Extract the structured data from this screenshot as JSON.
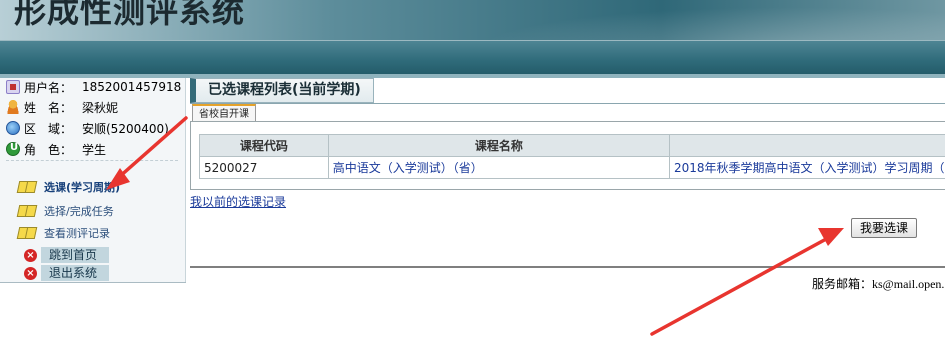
{
  "header": {
    "title": "形成性测评系统"
  },
  "sidebar": {
    "user_info": [
      {
        "icon": "user-card-icon",
        "label": "用户名：",
        "value": "1852001457918"
      },
      {
        "icon": "person-icon",
        "label": "姓　名：",
        "value": "梁秋妮"
      },
      {
        "icon": "globe-icon",
        "label": "区　域：",
        "value": "安顺(5200400)"
      },
      {
        "icon": "role-icon",
        "label": "角　色：",
        "value": "学生"
      }
    ],
    "menu": [
      {
        "icon": "book-icon",
        "label": "选课(学习周期)",
        "active": true
      },
      {
        "icon": "book-icon",
        "label": "选择/完成任务",
        "active": false
      },
      {
        "icon": "book-icon",
        "label": "查看测评记录",
        "active": false
      }
    ],
    "system": [
      {
        "icon": "close-icon",
        "label": "跳到首页"
      },
      {
        "icon": "close-icon",
        "label": "退出系统"
      }
    ]
  },
  "main": {
    "title": "已选课程列表(当前学期)",
    "tab": "省校自开课",
    "table": {
      "headers": [
        "课程代码",
        "课程名称",
        ""
      ],
      "rows": [
        {
          "code": "5200027",
          "name": "高中语文（入学测试）（省）",
          "period": "2018年秋季学期高中语文（入学测试）学习周期（"
        }
      ]
    },
    "history_link": "我以前的选课记录",
    "select_button": "我要选课",
    "footer": {
      "label": "服务邮箱：",
      "email": "ks@mail.open."
    }
  },
  "colors": {
    "banner": "#2f6878",
    "link": "#1a3a9a",
    "annotation_arrow": "#e8352f",
    "close_icon": "#d42626"
  }
}
